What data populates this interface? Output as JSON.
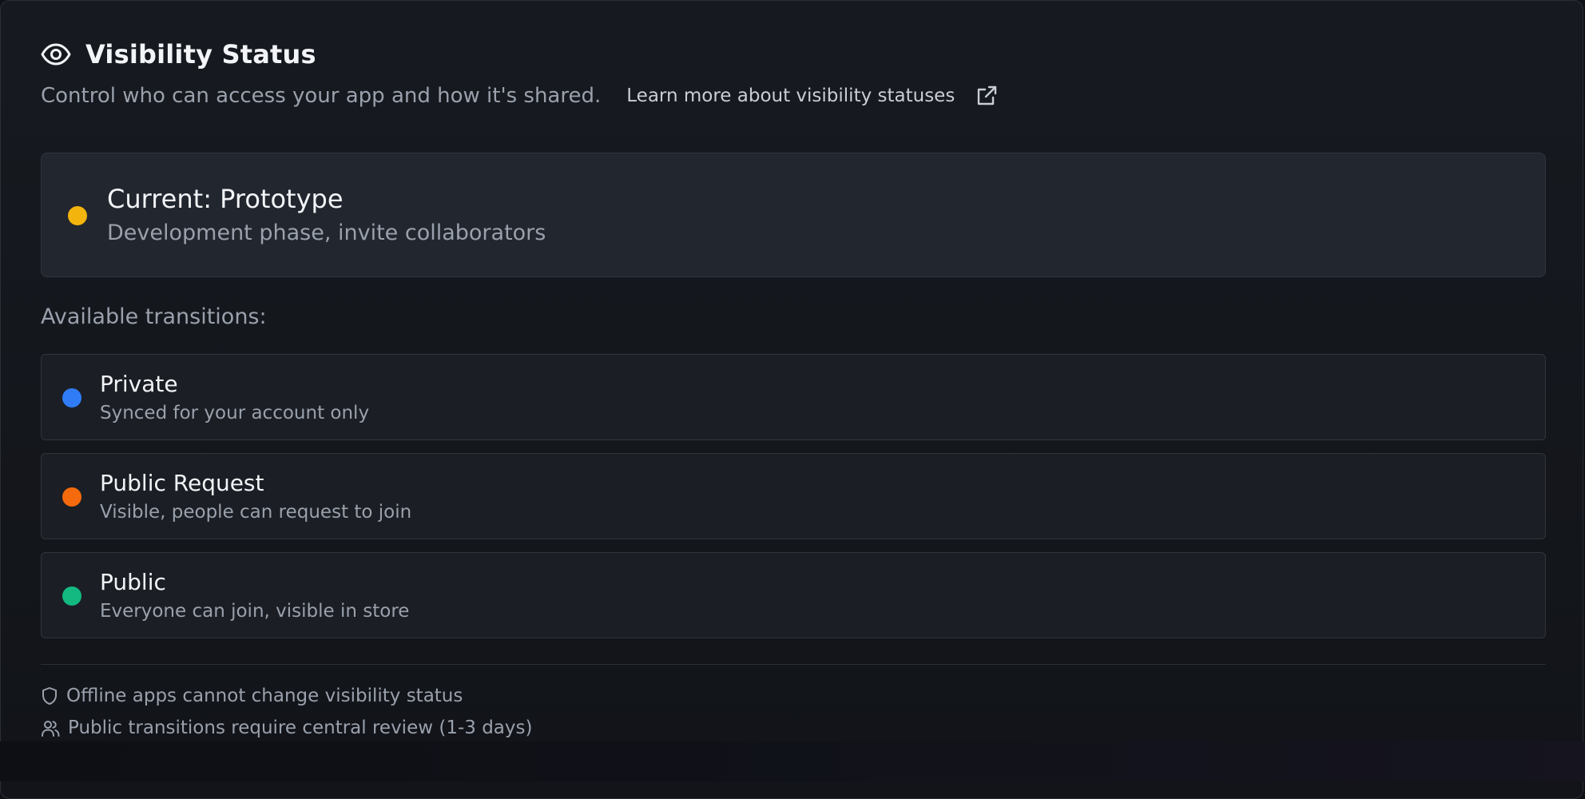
{
  "header": {
    "title": "Visibility Status",
    "subtitle": "Control who can access your app and how it's shared.",
    "learn_more": "Learn more about visibility statuses"
  },
  "current": {
    "title": "Current: Prototype",
    "description": "Development phase, invite collaborators",
    "color": "#f2b40d"
  },
  "transitions": {
    "label": "Available transitions:",
    "options": [
      {
        "title": "Private",
        "description": "Synced for your account only",
        "color": "#2f7cf6"
      },
      {
        "title": "Public Request",
        "description": "Visible, people can request to join",
        "color": "#f56a0d"
      },
      {
        "title": "Public",
        "description": "Everyone can join, visible in store",
        "color": "#13b981"
      }
    ]
  },
  "notes": [
    {
      "icon": "shield-icon",
      "text": "Offline apps cannot change visibility status"
    },
    {
      "icon": "users-icon",
      "text": "Public transitions require central review (1-3 days)"
    }
  ]
}
